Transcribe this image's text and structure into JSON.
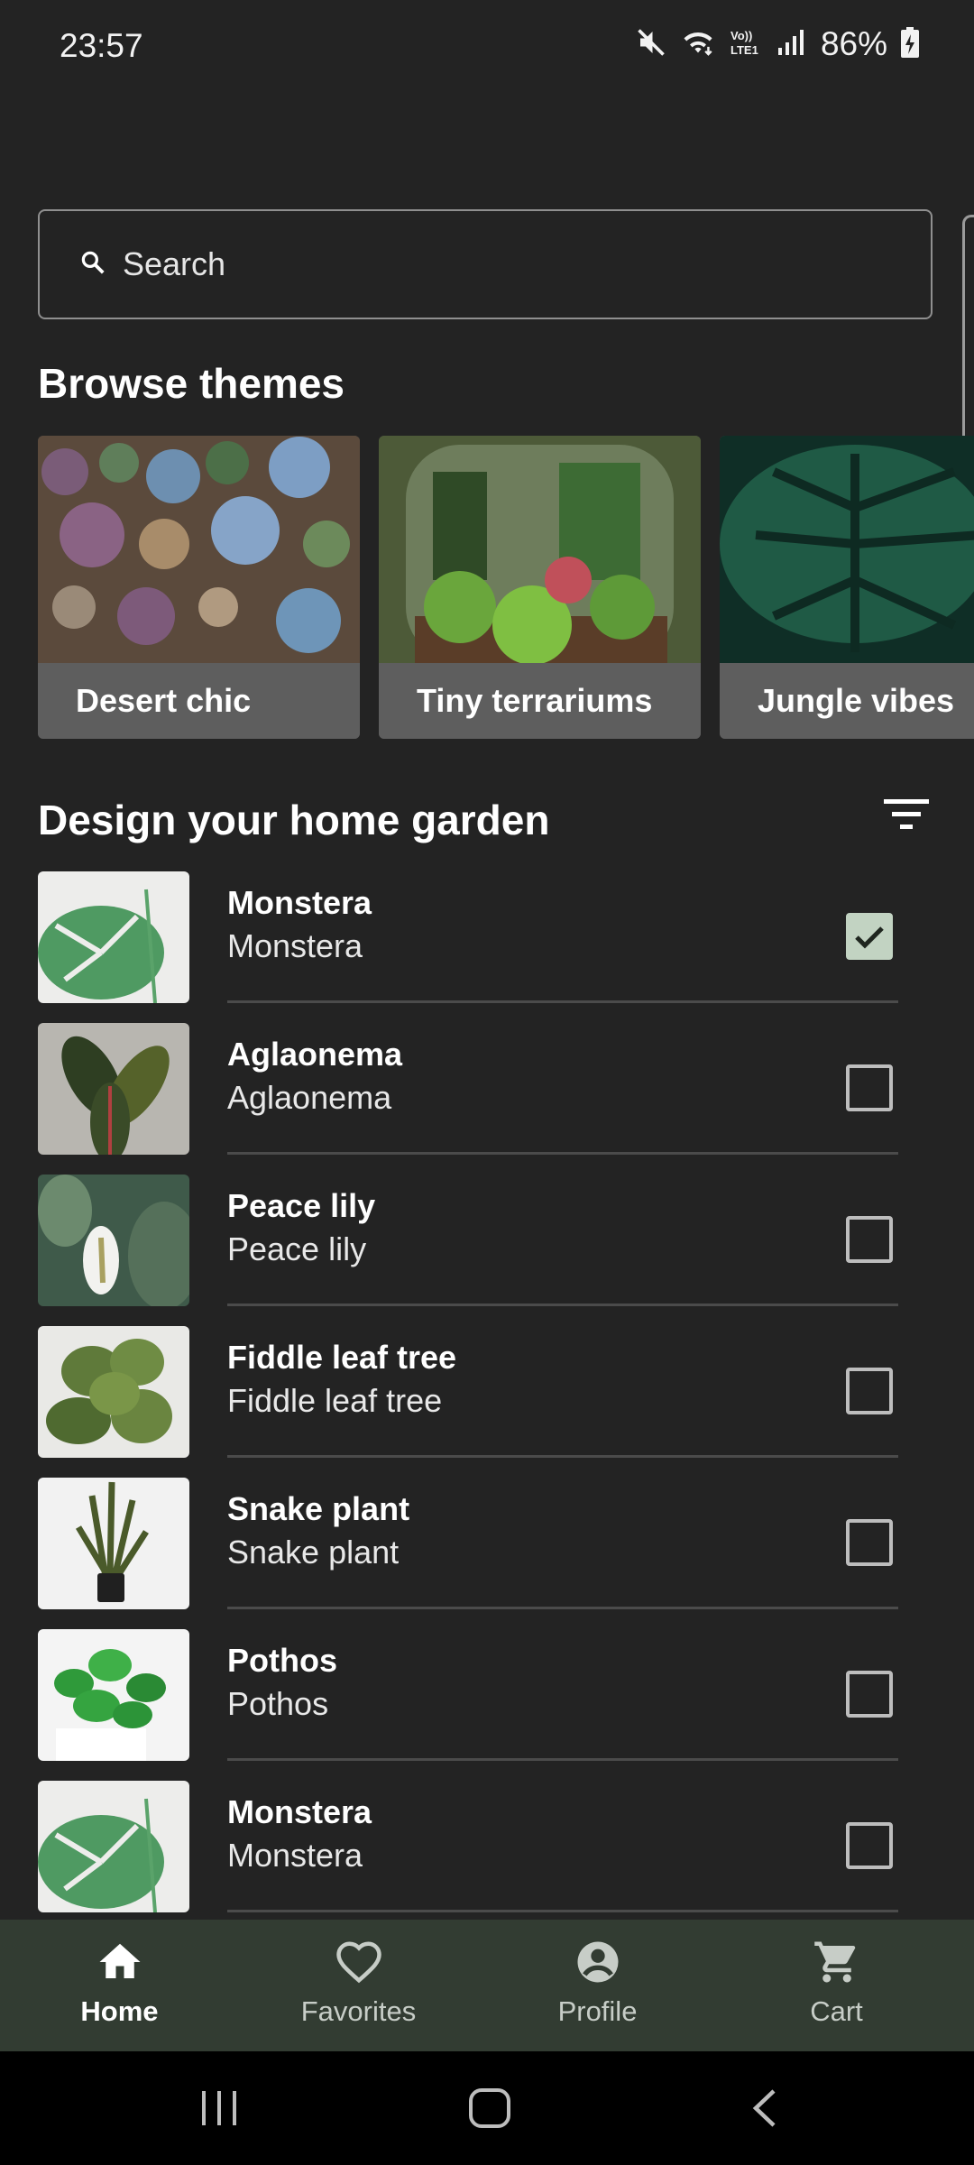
{
  "status_bar": {
    "time": "23:57",
    "battery": "86%",
    "icons": [
      "mute-icon",
      "wifi-icon",
      "volte-icon",
      "signal-icon",
      "battery-charging-icon"
    ]
  },
  "search": {
    "placeholder": "Search"
  },
  "themes": {
    "title": "Browse themes",
    "items": [
      {
        "label": "Desert chic"
      },
      {
        "label": "Tiny terrariums"
      },
      {
        "label": "Jungle vibes"
      }
    ]
  },
  "garden": {
    "title": "Design your home garden",
    "plants": [
      {
        "name": "Monstera",
        "subtitle": "Monstera",
        "checked": true
      },
      {
        "name": "Aglaonema",
        "subtitle": "Aglaonema",
        "checked": false
      },
      {
        "name": "Peace lily",
        "subtitle": "Peace lily",
        "checked": false
      },
      {
        "name": "Fiddle leaf tree",
        "subtitle": "Fiddle leaf tree",
        "checked": false
      },
      {
        "name": "Snake plant",
        "subtitle": "Snake plant",
        "checked": false
      },
      {
        "name": "Pothos",
        "subtitle": "Pothos",
        "checked": false
      },
      {
        "name": "Monstera",
        "subtitle": "Monstera",
        "checked": false
      }
    ]
  },
  "bottom_nav": {
    "items": [
      {
        "label": "Home",
        "icon": "home-icon",
        "active": true
      },
      {
        "label": "Favorites",
        "icon": "heart-icon",
        "active": false
      },
      {
        "label": "Profile",
        "icon": "account-circle-icon",
        "active": false
      },
      {
        "label": "Cart",
        "icon": "cart-icon",
        "active": false
      }
    ]
  },
  "colors": {
    "background": "#232323",
    "nav_background": "#323c32",
    "checkbox_checked": "#c2d3c2"
  }
}
